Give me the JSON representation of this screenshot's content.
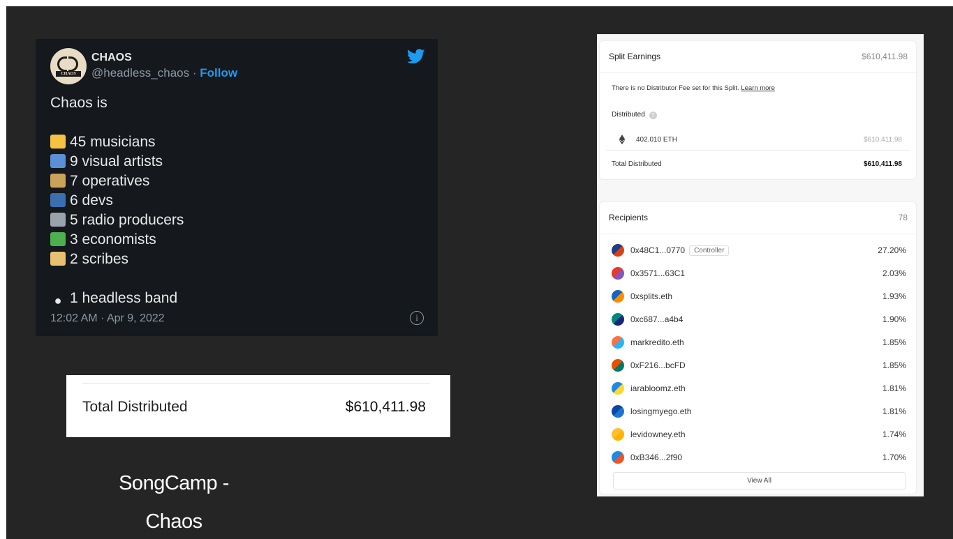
{
  "tweet": {
    "name": "CHAOS",
    "handle": "@headless_chaos",
    "separator": " · ",
    "follow_label": "Follow",
    "intro": "Chaos is",
    "lines": [
      {
        "icon": "cd-icon",
        "color": "#f5c242",
        "text": "45 musicians"
      },
      {
        "icon": "picture-icon",
        "color": "#5b8fd6",
        "text": "9 visual artists"
      },
      {
        "icon": "clipboard-icon",
        "color": "#c9a35a",
        "text": "7 operatives"
      },
      {
        "icon": "floppy-disk-icon",
        "color": "#3a6fb0",
        "text": "6 devs"
      },
      {
        "icon": "radio-icon",
        "color": "#9aa3ad",
        "text": "5 radio producers"
      },
      {
        "icon": "puzzle-piece-icon",
        "color": "#4caf50",
        "text": "3 economists"
      },
      {
        "icon": "scroll-icon",
        "color": "#e8c070",
        "text": "2 scribes"
      }
    ],
    "closing_icon": "eye-icon",
    "closing": "1 headless band",
    "timestamp": "12:02 AM · Apr 9, 2022"
  },
  "total_card": {
    "label": "Total Distributed",
    "value": "$610,411.98"
  },
  "caption": {
    "line1": "SongCamp -",
    "line2": "Chaos"
  },
  "split": {
    "title": "Split Earnings",
    "total": "$610,411.98",
    "fee_note": "There is no Distributor Fee set for this Split.",
    "learn_more": "Learn more",
    "distributed_label": "Distributed",
    "eth_amount": "402.010 ETH",
    "eth_usd": "$610,411.98",
    "total_distributed_label": "Total Distributed",
    "total_distributed_value": "$610,411.98"
  },
  "recipients": {
    "title": "Recipients",
    "count": "78",
    "controller_label": "Controller",
    "rows": [
      {
        "addr": "0x48C1...0770",
        "pct": "27.20%",
        "c1": "#1f3c88",
        "c2": "#d84315",
        "controller": true
      },
      {
        "addr": "0x3571...63C1",
        "pct": "2.03%",
        "c1": "#e53935",
        "c2": "#7e57c2"
      },
      {
        "addr": "0xsplits.eth",
        "pct": "1.93%",
        "c1": "#1565c0",
        "c2": "#fb8c00"
      },
      {
        "addr": "0xc687...a4b4",
        "pct": "1.90%",
        "c1": "#00897b",
        "c2": "#1a237e"
      },
      {
        "addr": "markredito.eth",
        "pct": "1.85%",
        "c1": "#ff7043",
        "c2": "#29b6f6"
      },
      {
        "addr": "0xF216...bcFD",
        "pct": "1.85%",
        "c1": "#e65100",
        "c2": "#00796b"
      },
      {
        "addr": "iarabloomz.eth",
        "pct": "1.81%",
        "c1": "#1e88e5",
        "c2": "#fdd835"
      },
      {
        "addr": "losingmyego.eth",
        "pct": "1.81%",
        "c1": "#0d47a1",
        "c2": "#1976d2"
      },
      {
        "addr": "levidowney.eth",
        "pct": "1.74%",
        "c1": "#fbc02d",
        "c2": "#ffb300"
      },
      {
        "addr": "0xB346...2f90",
        "pct": "1.70%",
        "c1": "#1e88e5",
        "c2": "#f4511e"
      }
    ],
    "view_all": "View All"
  }
}
